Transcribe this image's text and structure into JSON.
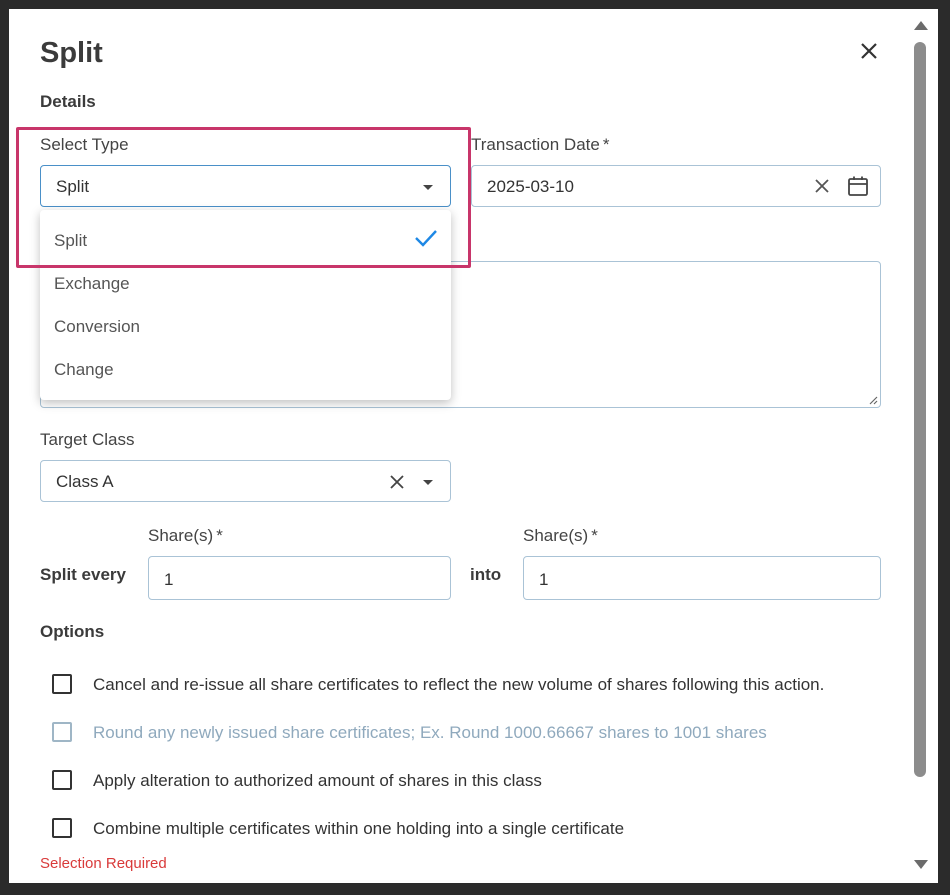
{
  "dialog": {
    "title": "Split"
  },
  "details": {
    "section_label": "Details",
    "select_type": {
      "label": "Select Type",
      "value": "Split",
      "options": [
        "Split",
        "Exchange",
        "Conversion",
        "Change"
      ]
    },
    "transaction_date": {
      "label": "Transaction Date",
      "required_mark": "*",
      "value": "2025-03-10"
    }
  },
  "target_class": {
    "label": "Target Class",
    "value": "Class A"
  },
  "split": {
    "prefix_label": "Split every",
    "middle_label": "into",
    "from": {
      "label": "Share(s)",
      "required_mark": "*",
      "value": "1"
    },
    "to": {
      "label": "Share(s)",
      "required_mark": "*",
      "value": "1"
    }
  },
  "options": {
    "section_label": "Options",
    "items": [
      {
        "label": "Cancel and re-issue all share certificates to reflect the new volume of shares following this action.",
        "disabled": false
      },
      {
        "label": "Round any newly issued share certificates; Ex. Round 1000.66667 shares to 1001 shares",
        "disabled": true
      },
      {
        "label": "Apply alteration to authorized amount of shares in this class",
        "disabled": false
      },
      {
        "label": "Combine multiple certificates within one holding into a single certificate",
        "disabled": false
      }
    ],
    "error": "Selection Required"
  },
  "colors": {
    "accent": "#1e88e5",
    "highlight": "#c8356a",
    "error": "#d93a3a",
    "field_border": "#aac3d6"
  }
}
